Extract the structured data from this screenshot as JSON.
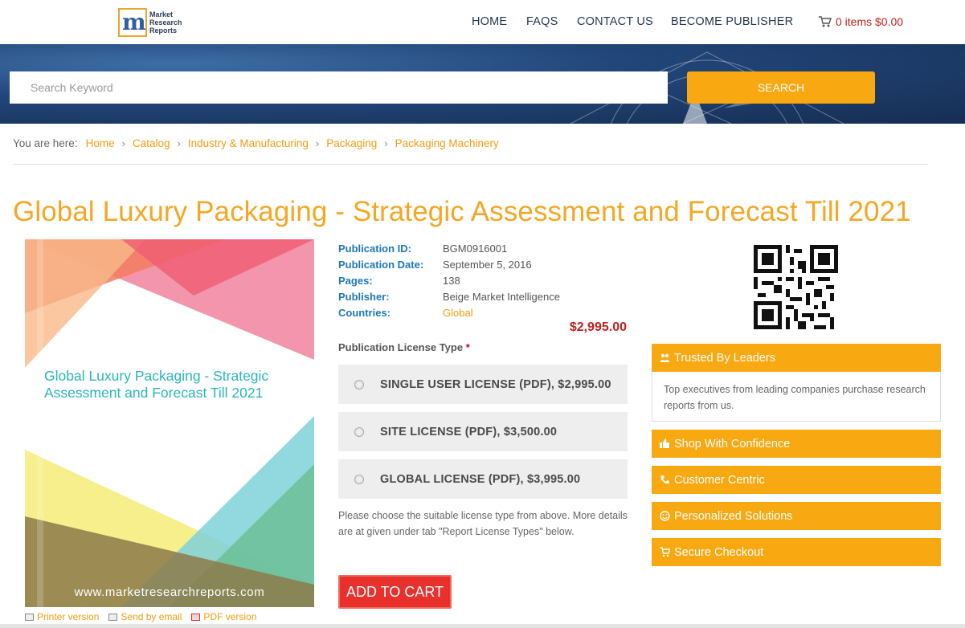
{
  "header": {
    "logo_text": [
      "Market",
      "Research",
      "Reports"
    ],
    "logo_mark": "m",
    "nav": [
      "HOME",
      "FAQS",
      "CONTACT US",
      "BECOME PUBLISHER"
    ],
    "cart": "0 items $0.00"
  },
  "search": {
    "placeholder": "Search Keyword",
    "button": "SEARCH"
  },
  "breadcrumb": {
    "prefix": "You are here:",
    "items": [
      "Home",
      "Catalog",
      "Industry & Manufacturing",
      "Packaging",
      "Packaging Machinery"
    ],
    "separator": "›"
  },
  "title": "Global Luxury Packaging - Strategic Assessment and Forecast Till 2021",
  "cover": {
    "title": "Global Luxury Packaging - Strategic Assessment and Forecast Till 2021",
    "url": "www.marketresearchreports.com"
  },
  "tools": [
    "Printer version",
    "Send by email",
    "PDF version"
  ],
  "meta": [
    {
      "key": "Publication ID:",
      "value": "BGM0916001"
    },
    {
      "key": "Publication Date:",
      "value": "September 5, 2016"
    },
    {
      "key": "Pages:",
      "value": "138"
    },
    {
      "key": "Publisher:",
      "value": "Beige Market Intelligence"
    },
    {
      "key": "Countries:",
      "value": "Global"
    }
  ],
  "price": "$2,995.00",
  "license": {
    "title": "Publication License Type",
    "required_mark": "*",
    "options": [
      "SINGLE USER LICENSE (PDF), $2,995.00",
      "SITE LICENSE (PDF), $3,500.00",
      "GLOBAL LICENSE (PDF), $3,995.00"
    ],
    "note": "Please choose the suitable license type from above. More details are at given under tab \"Report License Types\" below.",
    "add_to_cart": "ADD TO CART"
  },
  "sidebar": {
    "trusted_title": "Trusted By Leaders",
    "trusted_body": "Top executives from leading companies purchase research reports from us.",
    "items": [
      "Shop With Confidence",
      "Customer Centric",
      "Personalized Solutions",
      "Secure Checkout"
    ]
  },
  "colors": {
    "accent": "#f8a811",
    "title": "#f5a623",
    "link": "#f39c12",
    "price": "#c0211e",
    "meta_key": "#1c78b8",
    "add_to_cart": "#e8302d"
  }
}
